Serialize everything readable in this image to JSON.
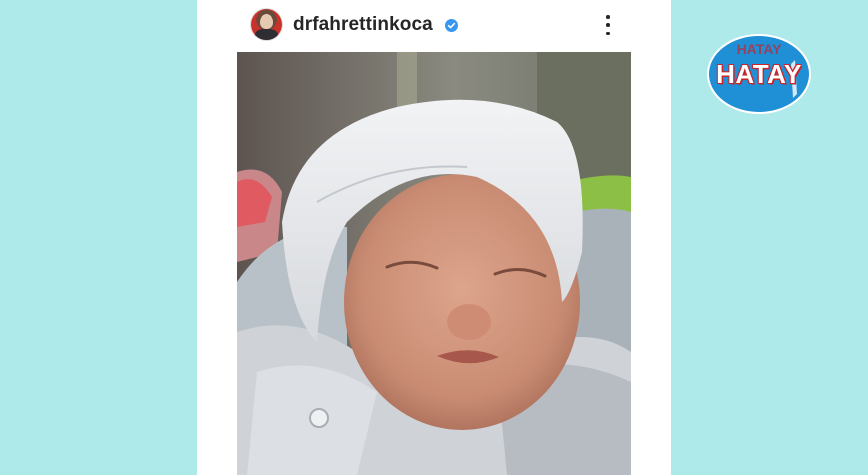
{
  "post": {
    "username": "drfahrettinkoca",
    "verified": true,
    "avatar": "profile-avatar",
    "more_icon": "more-options-vertical-dots-icon",
    "photo": "newborn-baby-sleeping-in-white-cap"
  },
  "watermark": {
    "text": "HATAY",
    "text_ghost": "HATAY"
  },
  "colors": {
    "background": "#aeeaea",
    "card": "#ffffff",
    "username": "#262626",
    "verified_badge": "#3897f0",
    "logo_blue": "#1f8fd6",
    "logo_red": "#c8242a"
  }
}
